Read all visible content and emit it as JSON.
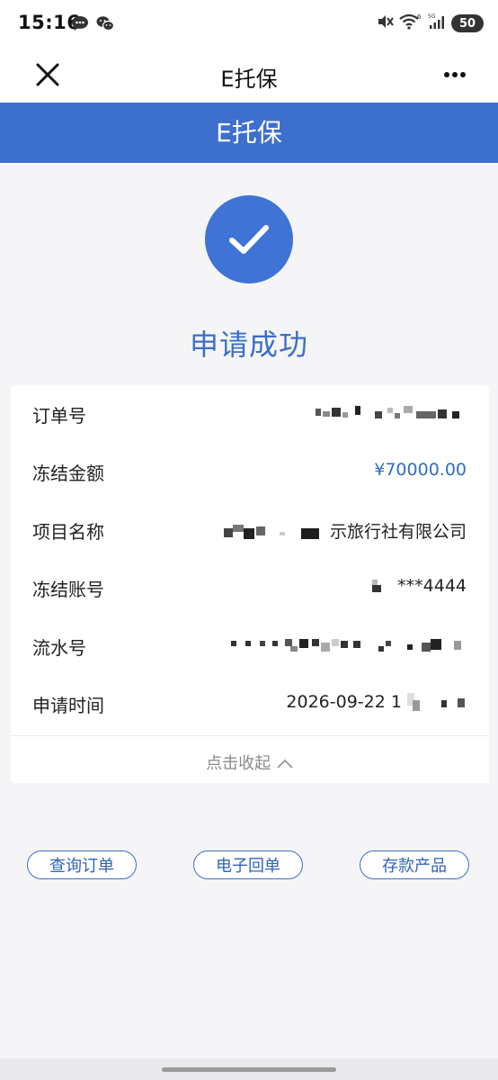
{
  "status_bar": {
    "time": "15:16",
    "battery": "50",
    "left_icons": [
      "chat-bubble-icon",
      "wechat-icon"
    ],
    "right_icons": [
      "mute-icon",
      "wifi-icon",
      "signal-icon"
    ]
  },
  "title_bar": {
    "title": "E托保",
    "close_icon": "close-icon",
    "more_icon": "more-dots-icon"
  },
  "header": {
    "title": "E托保",
    "color": "#3d6fce"
  },
  "result": {
    "icon": "check-circle-icon",
    "message": "申请成功",
    "color": "#3a6fc7"
  },
  "details": {
    "rows": [
      {
        "label": "订单号",
        "value": ""
      },
      {
        "label": "冻结金额",
        "value": "¥70000.00"
      },
      {
        "label": "项目名称",
        "value": "示旅行社有限公司"
      },
      {
        "label": "冻结账号",
        "value": "***4444"
      },
      {
        "label": "流水号",
        "value": ""
      },
      {
        "label": "申请时间",
        "value": "2026-09-22 1"
      }
    ],
    "collapse_label": "点击收起",
    "collapse_icon": "chevron-up-icon"
  },
  "actions": [
    {
      "label": "查询订单"
    },
    {
      "label": "电子回单"
    },
    {
      "label": "存款产品"
    }
  ]
}
